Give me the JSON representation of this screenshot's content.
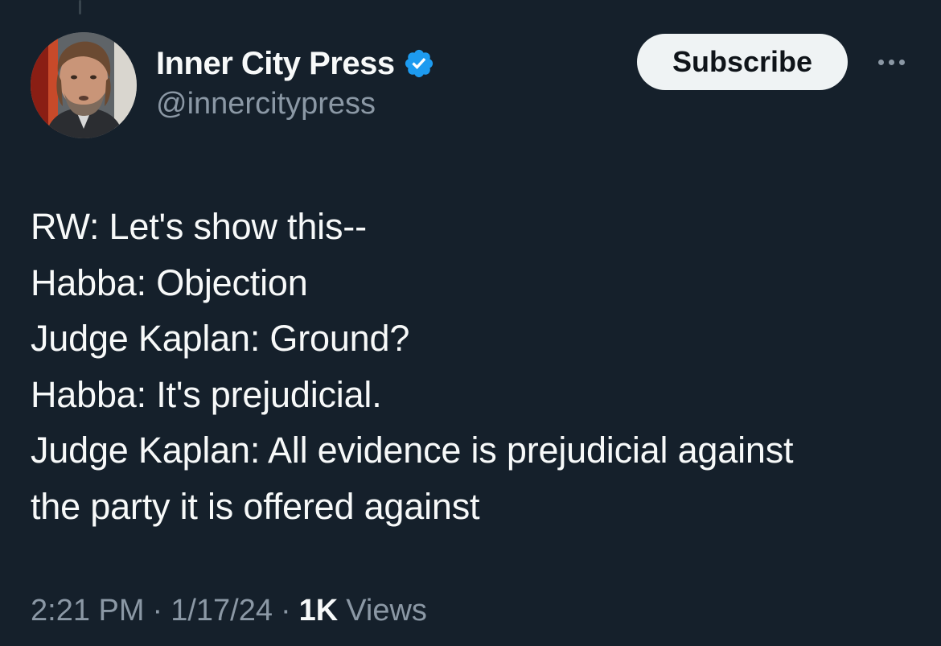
{
  "author": {
    "display_name": "Inner City Press",
    "handle": "@innercitypress",
    "verified": true,
    "verified_color": "#1d9bf0"
  },
  "actions": {
    "subscribe_label": "Subscribe",
    "more_icon": "more-horizontal-icon"
  },
  "tweet": {
    "lines": [
      "RW: Let's show this--",
      "Habba: Objection",
      "Judge Kaplan: Ground?",
      "Habba: It's prejudicial.",
      "Judge Kaplan: All evidence is prejudicial against",
      "the party it is offered against"
    ]
  },
  "meta": {
    "time": "2:21 PM",
    "separator": "·",
    "date": "1/17/24",
    "views_count": "1K",
    "views_label": "Views"
  },
  "colors": {
    "background": "#15202b",
    "text_primary": "#f7f9f9",
    "text_secondary": "#8b98a5",
    "button_bg": "#eff3f4"
  }
}
